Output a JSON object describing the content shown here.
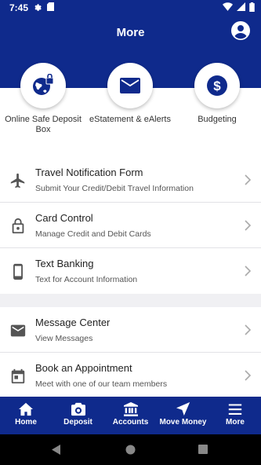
{
  "status_bar": {
    "time": "7:45"
  },
  "header": {
    "title": "More"
  },
  "quick_actions": [
    {
      "label": "Online Safe Deposit Box",
      "icon": "globe-lock-icon"
    },
    {
      "label": "eStatement & eAlerts",
      "icon": "envelope-icon"
    },
    {
      "label": "Budgeting",
      "icon": "dollar-circle-icon"
    }
  ],
  "menu_group_1": [
    {
      "title": "Travel Notification Form",
      "subtitle": "Submit Your Credit/Debit Travel Information",
      "icon": "airplane-icon"
    },
    {
      "title": "Card Control",
      "subtitle": "Manage Credit and Debit Cards",
      "icon": "lock-icon"
    },
    {
      "title": "Text Banking",
      "subtitle": "Text for Account Information",
      "icon": "phone-icon"
    }
  ],
  "menu_group_2": [
    {
      "title": "Message Center",
      "subtitle": "View Messages",
      "icon": "mail-icon"
    },
    {
      "title": "Book an Appointment",
      "subtitle": "Meet with one of our team members",
      "icon": "calendar-icon"
    }
  ],
  "bottom_nav": [
    {
      "label": "Home",
      "icon": "home-icon"
    },
    {
      "label": "Deposit",
      "icon": "camera-icon"
    },
    {
      "label": "Accounts",
      "icon": "bank-icon"
    },
    {
      "label": "Move Money",
      "icon": "send-arrow-icon"
    },
    {
      "label": "More",
      "icon": "menu-icon"
    }
  ],
  "colors": {
    "brand": "#0f2a8c",
    "background": "#f0f0f3",
    "icon_gray": "#555555"
  }
}
